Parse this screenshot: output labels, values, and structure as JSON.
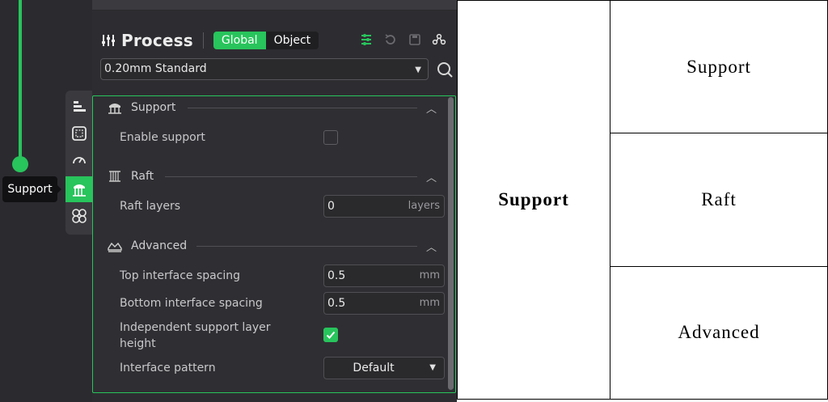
{
  "app": {
    "tooltip": "Support",
    "header": {
      "title": "Process",
      "scope_global": "Global",
      "scope_object": "Object",
      "icons": [
        "list-settings-icon",
        "reset-icon",
        "save-icon",
        "compare-icon"
      ]
    },
    "preset": {
      "value": "0.20mm Standard"
    },
    "rail_icons": [
      "quality-icon",
      "strength-icon",
      "speed-icon",
      "support-icon",
      "others-icon"
    ],
    "sections": {
      "support": {
        "title": "Support",
        "enable_label": "Enable support",
        "enable_checked": false
      },
      "raft": {
        "title": "Raft",
        "layers_label": "Raft layers",
        "layers_value": "0",
        "layers_unit": "layers"
      },
      "advanced": {
        "title": "Advanced",
        "top_label": "Top interface spacing",
        "top_value": "0.5",
        "top_unit": "mm",
        "bottom_label": "Bottom interface spacing",
        "bottom_value": "0.5",
        "bottom_unit": "mm",
        "independent_label_line1": "Independent support layer",
        "independent_label_line2": "height",
        "independent_checked": true,
        "pattern_label": "Interface pattern",
        "pattern_value": "Default"
      }
    },
    "colors": {
      "accent": "#28c45c",
      "panel": "#2f2f33",
      "background": "#2d2d31"
    }
  },
  "table": {
    "main_cell": "Support",
    "rows": [
      "Support",
      "Raft",
      "Advanced"
    ]
  }
}
